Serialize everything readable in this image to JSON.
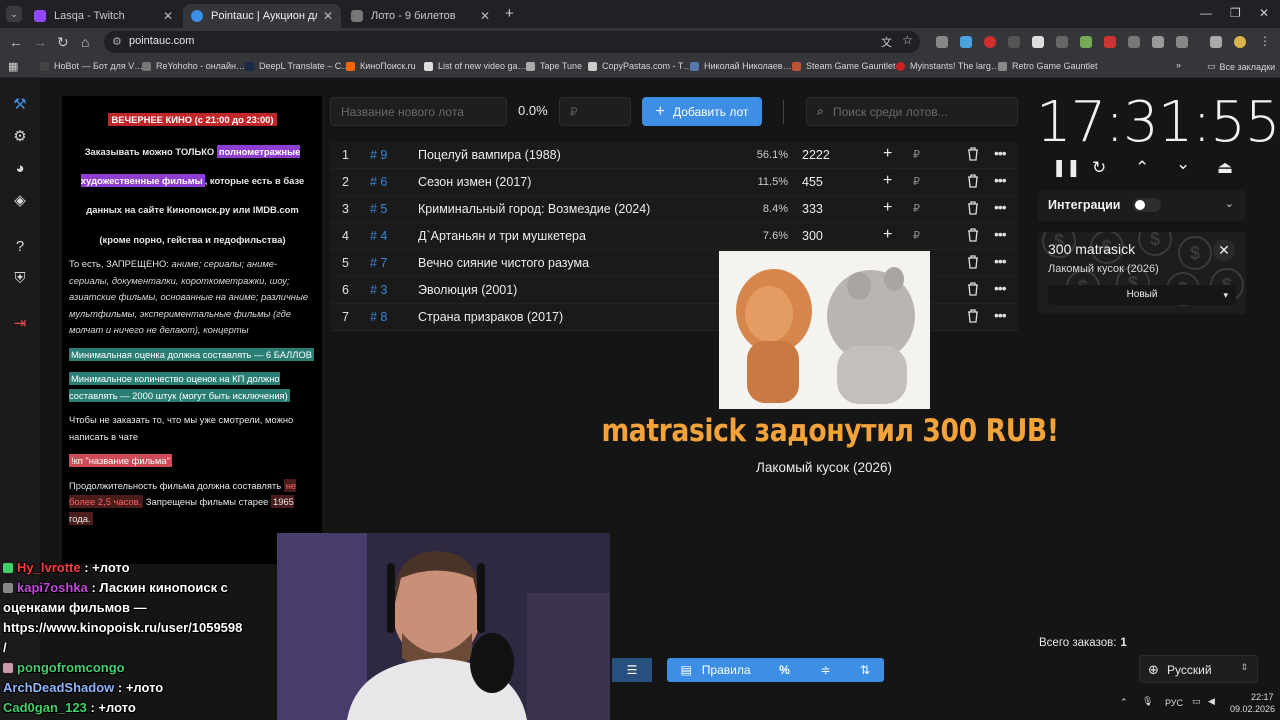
{
  "browser": {
    "tabs": [
      {
        "title": "Lasqa - Twitch",
        "color": "#9146ff",
        "active": false
      },
      {
        "title": "Pointauc | Аукцион для стрим…",
        "color": "#3d8fe6",
        "active": true
      },
      {
        "title": "Лото - 9 билетов",
        "color": "#888888",
        "active": false
      }
    ],
    "url": "pointauc.com",
    "bookmarks": [
      {
        "label": "HoBot — Бот для V…",
        "color": "#444444"
      },
      {
        "label": "ReYohoho - онлайн…",
        "color": "#777777"
      },
      {
        "label": "DeepL Translate – С…",
        "color": "#1b2a4a"
      },
      {
        "label": "КиноПоиск.ru",
        "color": "#ff6600"
      },
      {
        "label": "List of new video ga…",
        "color": "#dddddd"
      },
      {
        "label": "Tape Tune",
        "color": "#aaaaaa"
      },
      {
        "label": "CopyPastas.com - T…",
        "color": "#cccccc"
      },
      {
        "label": "Николай Николаев…",
        "color": "#5577aa"
      },
      {
        "label": "Steam Game Gauntlet",
        "color": "#bb5533"
      },
      {
        "label": "Myinstants! The larg…",
        "color": "#cc2222"
      },
      {
        "label": "Retro Game Gauntlet",
        "color": "#888888"
      }
    ],
    "all_bookmarks": "Все закладки"
  },
  "rules": {
    "title": "ВЕЧЕРНЕЕ КИНО (с 21:00 до 23:00)",
    "intro_1": "Заказывать можно ТОЛЬКО ",
    "intro_hl": "полнометражные художественные фильмы",
    "intro_2": ", которые есть в базе данных на сайте Кинопоиск.ру или IMDB.com",
    "except": "(кроме порно, гейства и педофильства)",
    "forbidden_lead": "То есть, ЗАПРЕЩЕНО: ",
    "forbidden_list": "аниме; сериалы; аниме-сериалы, документалки, короткометражки, шоу; азиатские фильмы, основанные на аниме; различные мультфильмы, экспериментальные фильмы (где молчат и ничего не делают), концерты",
    "min_rating": "Минимальная оценка должна составлять — 6 БАЛЛОВ",
    "min_votes": "Минимальное количество оценок на КП должно составлять — 2000 штук (могут быть исключения)",
    "no_repeat": "Чтобы не заказать то, что мы уже смотрели, можно написать в чате",
    "command": "!кп \"название фильма\"",
    "duration_1": "Продолжительность фильма должна составлять ",
    "duration_hl": "не более 2,5 часов.",
    "duration_2": " Запрещены фильмы старее ",
    "duration_year": "1965 года."
  },
  "controls": {
    "lot_placeholder": "Название нового лота",
    "percent": "0.0%",
    "amount_placeholder": "₽",
    "add_lot": "Добавить лот",
    "search_placeholder": "Поиск среди лотов..."
  },
  "lots": [
    {
      "idx": "1",
      "num": "# 9",
      "name": "Поцелуй вампира (1988)",
      "pct": "56.1%",
      "amount": "2222"
    },
    {
      "idx": "2",
      "num": "# 6",
      "name": "Сезон измен (2017)",
      "pct": "11.5%",
      "amount": "455"
    },
    {
      "idx": "3",
      "num": "# 5",
      "name": "Криминальный город: Возмездие (2024)",
      "pct": "8.4%",
      "amount": "333"
    },
    {
      "idx": "4",
      "num": "# 4",
      "name": "Д`Артаньян и три мушкетера",
      "pct": "7.6%",
      "amount": "300"
    },
    {
      "idx": "5",
      "num": "# 7",
      "name": "Вечно сияние чистого разума",
      "pct": "",
      "amount": ""
    },
    {
      "idx": "6",
      "num": "# 3",
      "name": "Эволюция (2001)",
      "pct": "",
      "amount": ""
    },
    {
      "idx": "7",
      "num": "# 8",
      "name": "Страна призраков (2017)",
      "pct": "",
      "amount": ""
    }
  ],
  "donation": {
    "text": "matrasick задонутил 300 RUB!",
    "subtitle": "Лакомый кусок (2026)"
  },
  "timer": "17:31:55",
  "integrations_label": "Интеграции",
  "bid": {
    "title": "300 matrasick",
    "subtitle": "Лакомый кусок (2026)",
    "status": "Новый"
  },
  "total_orders_label": "Всего заказов:",
  "total_orders_value": "1",
  "bottom": {
    "rules": "Правила",
    "percent": "%"
  },
  "language": "Русский",
  "chat": [
    {
      "user": "Hy_lvrotte",
      "color": "#ff3b3b",
      "msg": "+лото"
    },
    {
      "user": "kapi7oshka",
      "color": "#c04bd6",
      "msg": "Ласкин кинопоиск с"
    },
    {
      "user": "",
      "color": "#ffffff",
      "msg": "оценками фильмов —"
    },
    {
      "user": "",
      "color": "#ffffff",
      "msg": "https://www.kinopoisk.ru/user/1059598"
    },
    {
      "user": "",
      "color": "#ffffff",
      "msg": "/"
    },
    {
      "user": "pongofromcongo",
      "color": "#3fd16a",
      "msg": ""
    },
    {
      "user": "ArchDeadShadow",
      "color": "#8fb4ff",
      "msg": "+лото"
    },
    {
      "user": "Cad0gan_123",
      "color": "#3fd16a",
      "msg": "+лото"
    }
  ],
  "taskbar": {
    "lang": "РУС",
    "time": "22:17",
    "date": "09.02.2026"
  }
}
